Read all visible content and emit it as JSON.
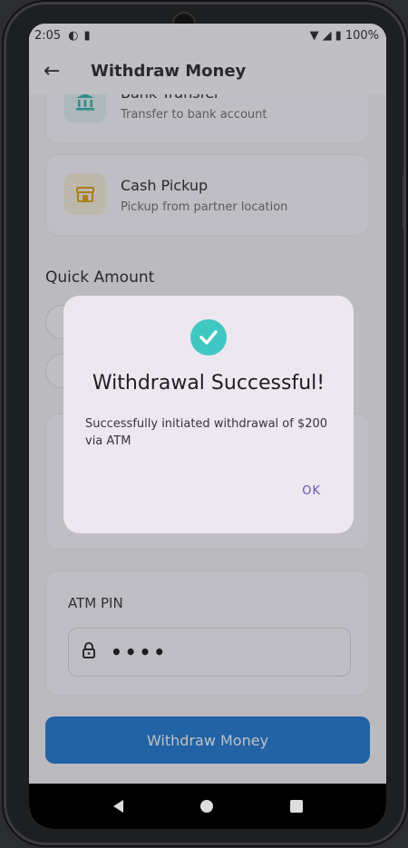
{
  "status_bar": {
    "time": "2:05",
    "battery": "100%"
  },
  "app_bar": {
    "title": "Withdraw Money"
  },
  "methods": [
    {
      "title": "Bank Transfer",
      "subtitle": "Transfer to bank account",
      "icon": "bank-icon",
      "color": "#2bb3a6"
    },
    {
      "title": "Cash Pickup",
      "subtitle": "Pickup from partner location",
      "icon": "store-icon",
      "color": "#e0a100"
    }
  ],
  "quick_amount": {
    "title": "Quick Amount"
  },
  "atm_pin": {
    "label": "ATM PIN",
    "value": "••••"
  },
  "withdraw_button": {
    "label": "Withdraw Money"
  },
  "dialog": {
    "title": "Withdrawal Successful!",
    "message": "Successfully initiated withdrawal of $200 via ATM",
    "ok_label": "OK",
    "accent": "#41c7c3"
  }
}
